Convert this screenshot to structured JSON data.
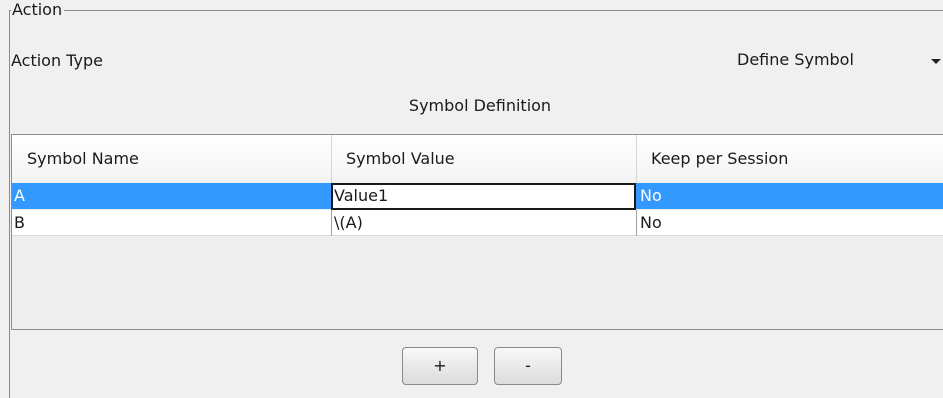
{
  "action_group": {
    "title": "Action"
  },
  "action_type": {
    "label": "Action Type",
    "selected": "Define Symbol"
  },
  "symbol_definition": {
    "title": "Symbol Definition",
    "columns": [
      "Symbol Name",
      "Symbol Value",
      "Keep per Session"
    ],
    "rows": [
      {
        "name": "A",
        "value": "Value1",
        "keep": "No",
        "selected": true
      },
      {
        "name": "B",
        "value": "\\(A)",
        "keep": "No",
        "selected": false
      }
    ]
  },
  "buttons": {
    "add_label": "+",
    "remove_label": "-"
  },
  "colors": {
    "selection": "#3399ff",
    "frame": "#8a8a8a",
    "background": "#f0f0f0"
  },
  "icons": {
    "dropdown": "chevron-down-icon"
  }
}
